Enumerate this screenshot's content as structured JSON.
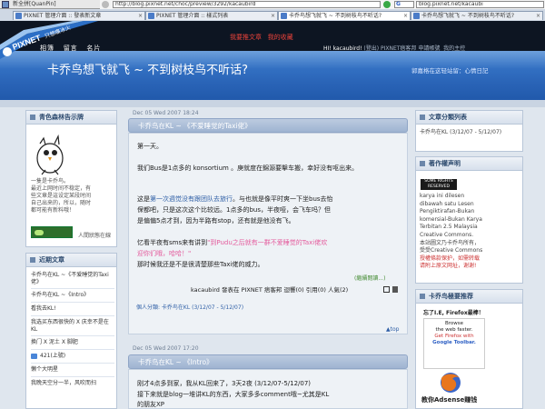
{
  "ime": {
    "label": "新全拼[QuanPin]"
  },
  "addressbar": {
    "url": "http://blog.pixnet.net/choc/preview/3292/kacaubird",
    "search_engine": "G",
    "url2": "blog.pixnet.net/kacaubi"
  },
  "tabs": [
    {
      "label": "PIXNET 管理介面 :: 發表新文章"
    },
    {
      "label": "PIXNET 管理介面 :: 樣式列表"
    },
    {
      "label": "卡乔鸟想飞就飞 ~ 不到树枝鸟不听话?"
    },
    {
      "label": "卡乔鸟想飞就飞 ~ 不到树枝鸟不听话?"
    }
  ],
  "ribbon": {
    "brand": "PIXNET",
    "slogan": "只想痛冰火"
  },
  "menu": {
    "items": [
      "相簿",
      "留言",
      "名片"
    ]
  },
  "redlinks": [
    "我要推文章",
    "我的收藏"
  ],
  "welcome": {
    "hi": "HI! kacaubird!",
    "links": "(登出) PIXNET痞客邦 申請帳號",
    "settings": "我的主控"
  },
  "blog": {
    "title": "卡乔鸟想飞就飞 ~ 不到树枝鸟不听话?",
    "subtitle": "郭嘉格在这轻站留：心情日記"
  },
  "profile": {
    "heading": "青色森林告示牌",
    "lines": [
      "一隻是卡乔鸟。",
      "最近上网时间不稳定，有",
      "些文章是這设定某段时间",
      "自己出来的，所以，随时",
      "都可能有新料哦！"
    ],
    "status_label": "人間狀態在線"
  },
  "recent": {
    "heading": "近期文章",
    "items": [
      "卡乔鸟在KL ~《不爱睡觉的Taxi佬》",
      "卡乔鸟在KL ~《Intro》",
      "看我去KL!",
      "我选买东西很快的 X 庆幸不是在KL",
      "换门 X 泥土 X 脚肥",
      "421(上號)",
      "懒个大明星",
      "我晚天空分一半，风吹而扫"
    ]
  },
  "posts": [
    {
      "date": "Dec 05 Wed 2007 18:24",
      "title": "卡乔鸟在KL ~ 《不爱睡觉的Taxi佬》",
      "p1": "第一天。",
      "p2a": "我们Bus是1点多的 konsortium 。庚就度在錦源要擊车搬，幸好没有呕出来。",
      "p3a": "这是",
      "p3link": "第一次週觉没有跟团队去旅行",
      "p3b": "。与也就是像平时爽一下坐bus去怡",
      "p3c": "保都吧，只是这次这个比较远。1点多的bus，半夜哑，会飞车吗？但",
      "p3d": "是偏偏5点才到，因为半路有stop，还有就是他没有飞。",
      "p4a": "忆看半夜有sms来有讲到",
      "p4pink1": "\"到Pudu之后就有一群不爱睡觉的Taxi佬欢",
      "p4pink2": "迎你们哦，哈哈！\"",
      "p4b": "那时候我还是不是很清楚那些Taxi佬的威力。",
      "readmore": "(繼續閱讀...)",
      "author": "kacaubird",
      "meta": "發表在 PIXNET 痞客邦 迴響(0) 引用(0) 人氣(2)",
      "category": "個人分類: 卡乔鸟在KL (3/12/07 - 5/12/07)",
      "top": "top"
    },
    {
      "date": "Dec 05 Wed 2007 17:20",
      "title": "卡乔鸟在KL ~ 《Intro》",
      "l1": "刚才4点多到家，我从KL回来了，3天2夜 (3/12/07-5/12/07)",
      "l2": "接下来就是blog一堆讲KL的东西，大家多多comment哦~尤其是KL",
      "l3": "的朋友XP"
    }
  ],
  "right": {
    "cats_heading": "文章分類列表",
    "cat_item": "卡乔鸟在KL (3/12/07 - 5/12/07)",
    "license_heading": "著作權声明",
    "cc_label": "SOME RIGHTS RESERVED",
    "license_lines": [
      "karya ini dilesen",
      "dibawah satu Lesen",
      "Pengiktirafan-Bukan",
      "komersial-Bukan Karya",
      "Terbitan 2.5 Malaysia",
      "Creative Commons.",
      "本站圖文乃卡乔鸟所有，",
      "受受Creative Commons",
      "授權條款保护，如需转载",
      "请附上原文网址，谢谢!"
    ],
    "ff_heading": "卡乔鸟極要推荐",
    "ff_promo": "忘了I.E, Firefox最棒！",
    "ff_ad_lines": [
      "Browse",
      "the web faster.",
      "Get Firefox with",
      "Google Toolbar."
    ],
    "adsense": "教你Adsense赚钱"
  },
  "colors": {
    "banner": "#2a64b7",
    "accent_red": "#e8423a",
    "pink": "#e45c9d",
    "post_header": "#9fb4d2"
  }
}
